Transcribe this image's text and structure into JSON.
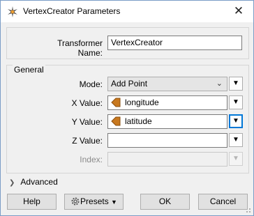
{
  "window": {
    "title": "VertexCreator Parameters",
    "close_glyph": "✕"
  },
  "transformer_name": {
    "label": "Transformer Name:",
    "value": "VertexCreator"
  },
  "general": {
    "title": "General",
    "mode": {
      "label": "Mode:",
      "value": "Add Point"
    },
    "x_value": {
      "label": "X Value:",
      "value": "longitude"
    },
    "y_value": {
      "label": "Y Value:",
      "value": "latitude"
    },
    "z_value": {
      "label": "Z Value:",
      "value": ""
    },
    "index": {
      "label": "Index:",
      "value": ""
    }
  },
  "advanced": {
    "label": "Advanced"
  },
  "buttons": {
    "help": "Help",
    "presets": "Presets",
    "ok": "OK",
    "cancel": "Cancel"
  },
  "colors": {
    "focus_border": "#0078d7",
    "attribute_icon": "#c8781e"
  }
}
